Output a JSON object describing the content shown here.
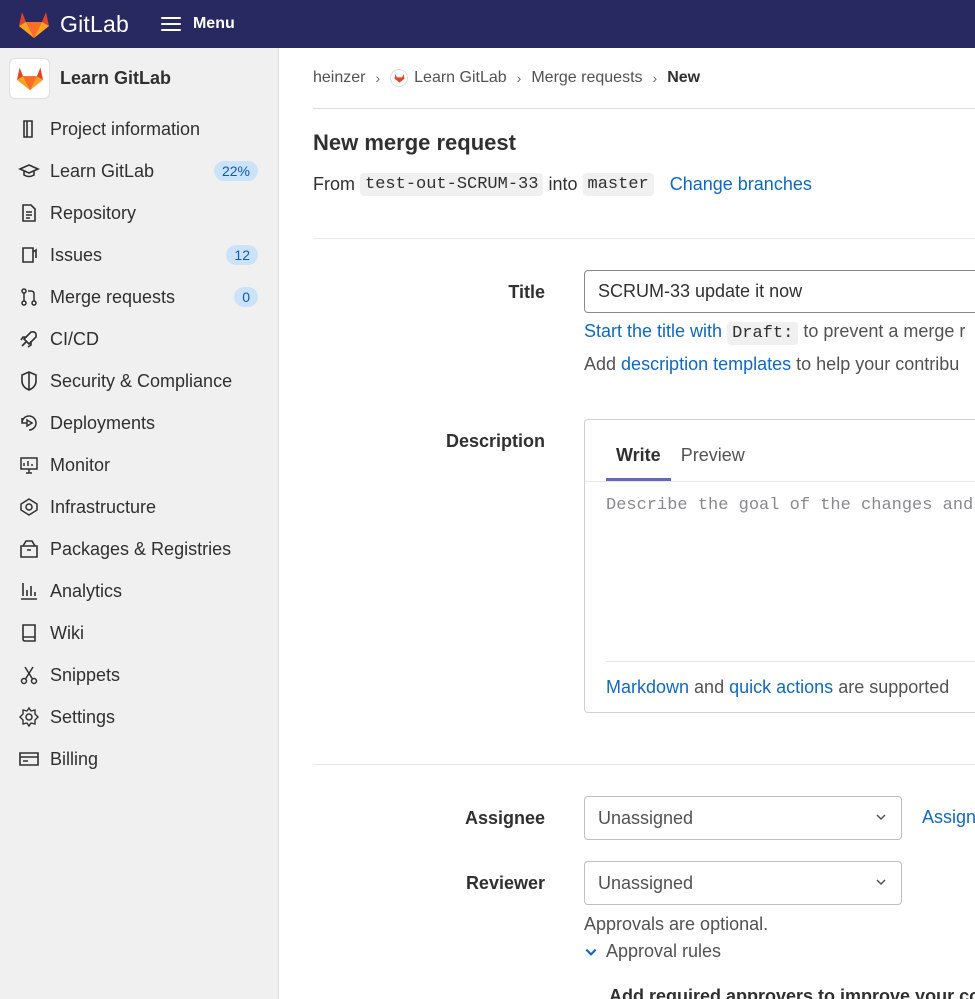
{
  "topbar": {
    "brand": "GitLab",
    "menu_label": "Menu"
  },
  "sidebar": {
    "project_name": "Learn GitLab",
    "items": [
      {
        "label": "Project information",
        "icon": "project-info-icon"
      },
      {
        "label": "Learn GitLab",
        "icon": "learn-icon",
        "badge": "22%"
      },
      {
        "label": "Repository",
        "icon": "repository-icon"
      },
      {
        "label": "Issues",
        "icon": "issues-icon",
        "badge": "12"
      },
      {
        "label": "Merge requests",
        "icon": "merge-request-icon",
        "badge": "0"
      },
      {
        "label": "CI/CD",
        "icon": "rocket-icon"
      },
      {
        "label": "Security & Compliance",
        "icon": "shield-icon"
      },
      {
        "label": "Deployments",
        "icon": "deployments-icon"
      },
      {
        "label": "Monitor",
        "icon": "monitor-icon"
      },
      {
        "label": "Infrastructure",
        "icon": "infrastructure-icon"
      },
      {
        "label": "Packages & Registries",
        "icon": "package-icon"
      },
      {
        "label": "Analytics",
        "icon": "chart-icon"
      },
      {
        "label": "Wiki",
        "icon": "book-icon"
      },
      {
        "label": "Snippets",
        "icon": "scissors-icon"
      },
      {
        "label": "Settings",
        "icon": "gear-icon"
      },
      {
        "label": "Billing",
        "icon": "credit-card-icon"
      }
    ]
  },
  "breadcrumb": {
    "user": "heinzer",
    "project": "Learn GitLab",
    "section": "Merge requests",
    "current": "New"
  },
  "page": {
    "title": "New merge request",
    "from_label": "From",
    "source_branch": "test-out-SCRUM-33",
    "into_label": "into",
    "target_branch": "master",
    "change_branches": "Change branches"
  },
  "form": {
    "title_label": "Title",
    "title_value": "SCRUM-33 update it now",
    "draft_link": "Start the title with",
    "draft_code": "Draft:",
    "draft_rest": "to prevent a merge r",
    "templates_prefix": "Add",
    "templates_link": "description templates",
    "templates_rest": "to help your contribu",
    "description_label": "Description",
    "tab_write": "Write",
    "tab_preview": "Preview",
    "description_placeholder": "Describe the goal of the changes and",
    "markdown_link": "Markdown",
    "and_text": "and",
    "quick_actions_link": "quick actions",
    "supported_text": "are supported",
    "assignee_label": "Assignee",
    "assignee_value": "Unassigned",
    "assign_link": "Assign",
    "reviewer_label": "Reviewer",
    "reviewer_value": "Unassigned",
    "approvals_text": "Approvals are optional.",
    "approval_rules": "Approval rules",
    "approvers_text": "Add required approvers to improve your co"
  },
  "colors": {
    "topbar": "#292961",
    "link": "#1068bf",
    "sidebar": "#f0f0f0",
    "tab_underline": "#6666c4"
  }
}
